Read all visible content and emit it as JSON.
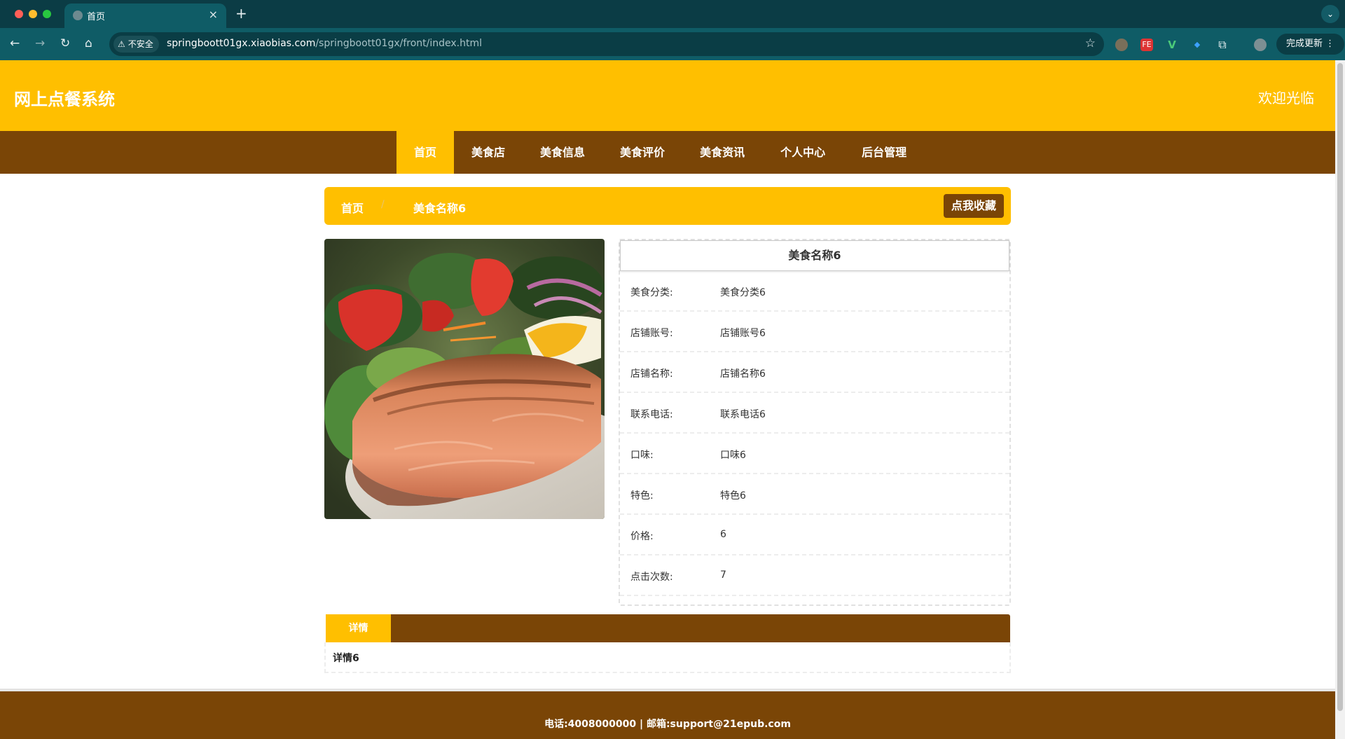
{
  "browser": {
    "tab_title": "首页",
    "tab_close": "×",
    "new_tab": "+",
    "security_label": "不安全",
    "url_host": "springboott01gx.xiaobias.com",
    "url_path": "/springboott01gx/front/index.html",
    "update_label": "完成更新",
    "extensions": {
      "fe_label": "FE",
      "v_label": "V"
    }
  },
  "site": {
    "title": "网上点餐系统",
    "welcome": "欢迎光临"
  },
  "nav": {
    "items": [
      {
        "label": "首页",
        "active": true
      },
      {
        "label": "美食店"
      },
      {
        "label": "美食信息"
      },
      {
        "label": "美食评价"
      },
      {
        "label": "美食资讯"
      },
      {
        "label": "个人中心"
      },
      {
        "label": "后台管理"
      }
    ]
  },
  "breadcrumb": {
    "home": "首页",
    "separator": "/",
    "current": "美食名称6",
    "favorite_button": "点我收藏"
  },
  "detail": {
    "title": "美食名称6",
    "rows": [
      {
        "label": "美食分类:",
        "value": "美食分类6"
      },
      {
        "label": "店铺账号:",
        "value": "店铺账号6"
      },
      {
        "label": "店铺名称:",
        "value": "店铺名称6"
      },
      {
        "label": "联系电话:",
        "value": "联系电话6"
      },
      {
        "label": "口味:",
        "value": "口味6"
      },
      {
        "label": "特色:",
        "value": "特色6"
      },
      {
        "label": "价格:",
        "value": "6"
      },
      {
        "label": "点击次数:",
        "value": "7"
      }
    ]
  },
  "tabs": {
    "detail_tab": "详情",
    "detail_content": "详情6"
  },
  "footer": {
    "text": "电话:4008000000 | 邮箱:support@21epub.com"
  },
  "colors": {
    "accent": "#ffbf00",
    "brown": "#7a4506",
    "browser_dark": "#0b3c45",
    "browser_toolbar": "#0f5c66"
  }
}
